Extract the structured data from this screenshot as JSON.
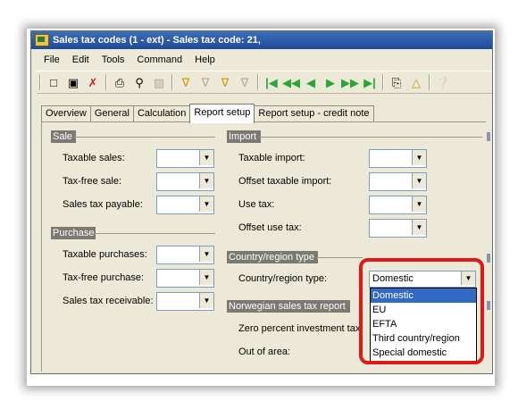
{
  "window": {
    "title": "Sales tax codes (1 - ext) - Sales tax code: 21,"
  },
  "menu": [
    "File",
    "Edit",
    "Tools",
    "Command",
    "Help"
  ],
  "toolbar": {
    "icons": [
      "new-icon",
      "save-icon",
      "delete-icon",
      "print-icon",
      "print-preview-icon",
      "refresh-icon",
      "filter-icon",
      "filter-by-selection-icon",
      "advanced-filter-icon",
      "remove-filter-icon",
      "first-record-icon",
      "previous-page-icon",
      "previous-record-icon",
      "next-record-icon",
      "next-page-icon",
      "last-record-icon",
      "attach-icon",
      "alert-icon",
      "help-icon"
    ]
  },
  "tabs": [
    "Overview",
    "General",
    "Calculation",
    "Report setup",
    "Report setup - credit note"
  ],
  "active_tab": "Report setup",
  "groups": {
    "sale": {
      "title": "Sale",
      "fields": [
        "Taxable sales:",
        "Tax-free sale:",
        "Sales tax payable:"
      ]
    },
    "purchase": {
      "title": "Purchase",
      "fields": [
        "Taxable purchases:",
        "Tax-free purchase:",
        "Sales tax receivable:"
      ]
    },
    "import": {
      "title": "Import",
      "fields": [
        "Taxable import:",
        "Offset taxable import:",
        "Use tax:",
        "Offset use tax:"
      ]
    },
    "country": {
      "title": "Country/region type",
      "field": "Country/region type:",
      "value": "Domestic"
    },
    "norwegian": {
      "title": "Norwegian sales tax report",
      "fields": [
        "Zero percent investment tax",
        "Out of area:"
      ]
    }
  },
  "dropdown": {
    "options": [
      "Domestic",
      "EU",
      "EFTA",
      "Third country/region",
      "Special domestic"
    ],
    "selected": "Domestic"
  },
  "colors": {
    "highlight": "#e01818",
    "selection": "#316ac5",
    "titlebar": "#1d4a98"
  }
}
